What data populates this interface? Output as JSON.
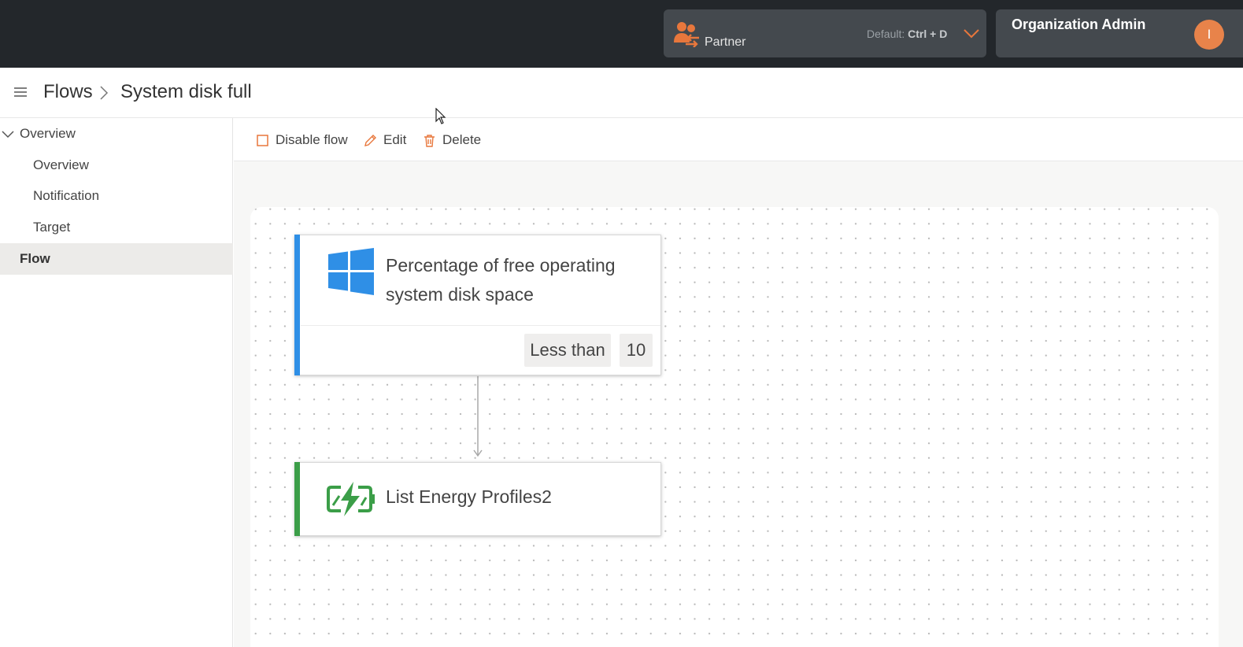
{
  "topbar": {
    "partner": {
      "label": "Partner",
      "shortcut_prefix": "Default:",
      "shortcut_keys": "Ctrl + D",
      "icon": "users-switch-icon"
    },
    "org": {
      "label": "Organization Admin",
      "avatar_initial": "I"
    }
  },
  "breadcrumb": {
    "root": "Flows",
    "current": "System disk full"
  },
  "sidebar": {
    "group_label": "Overview",
    "items": [
      {
        "label": "Overview"
      },
      {
        "label": "Notification"
      },
      {
        "label": "Target"
      }
    ],
    "active_label": "Flow"
  },
  "toolbar": {
    "disable_label": "Disable flow",
    "edit_label": "Edit",
    "delete_label": "Delete"
  },
  "flow": {
    "trigger": {
      "icon": "windows-logo-icon",
      "title": "Percentage of free operating system disk space",
      "operator": "Less than",
      "value": "10"
    },
    "action": {
      "icon": "battery-charging-icon",
      "title": "List Energy Profiles2"
    }
  },
  "colors": {
    "topbar_bg": "#23272b",
    "accent_orange": "#e8834a",
    "trigger_accent": "#2f8fe6",
    "action_accent": "#3b9e48"
  }
}
